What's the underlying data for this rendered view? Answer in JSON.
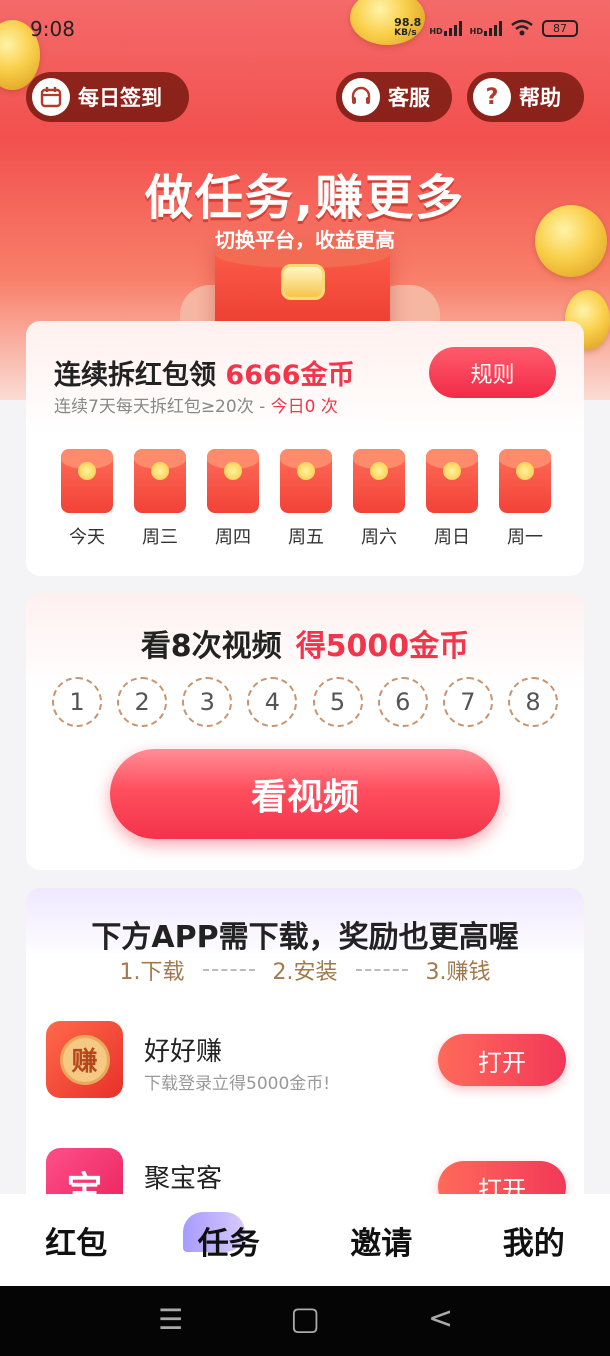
{
  "status_bar": {
    "time": "9:08",
    "net_speed": "98.8",
    "net_unit": "KB/s",
    "hd1": "HD",
    "hd2": "HD",
    "battery": "87"
  },
  "header": {
    "checkin_label": "每日签到",
    "service_label": "客服",
    "help_label": "帮助",
    "title": "做任务,赚更多",
    "subtitle": "切换平台，收益更高"
  },
  "redpacket": {
    "title_prefix": "连续拆红包领 ",
    "title_highlight": "6666金币",
    "subtitle_prefix": "连续7天每天拆红包≥20次 - ",
    "subtitle_highlight": "今日0 次",
    "rule_button": "规则",
    "days": [
      "今天",
      "周三",
      "周四",
      "周五",
      "周六",
      "周日",
      "周一"
    ]
  },
  "video": {
    "title_prefix": "看8次视频",
    "title_highlight": "得5000金币",
    "counts": [
      "1",
      "2",
      "3",
      "4",
      "5",
      "6",
      "7",
      "8"
    ],
    "button": "看视频"
  },
  "apps": {
    "title": "下方APP需下载，奖励也更高喔",
    "steps": [
      "1.下载",
      "2.安装",
      "3.赚钱"
    ],
    "items": [
      {
        "name": "好好赚",
        "desc": "下载登录立得5000金币!",
        "button": "打开",
        "icon_char": "赚",
        "color": "#f2473a"
      },
      {
        "name": "聚宝客",
        "desc": "",
        "button": "打开",
        "icon_char": "宝",
        "color": "#f23a6a"
      }
    ]
  },
  "bottom_nav": {
    "tabs": [
      "红包",
      "任务",
      "邀请",
      "我的"
    ],
    "active": "任务"
  },
  "system_nav": {
    "menu": "☰",
    "home": "▢",
    "back": "<"
  }
}
